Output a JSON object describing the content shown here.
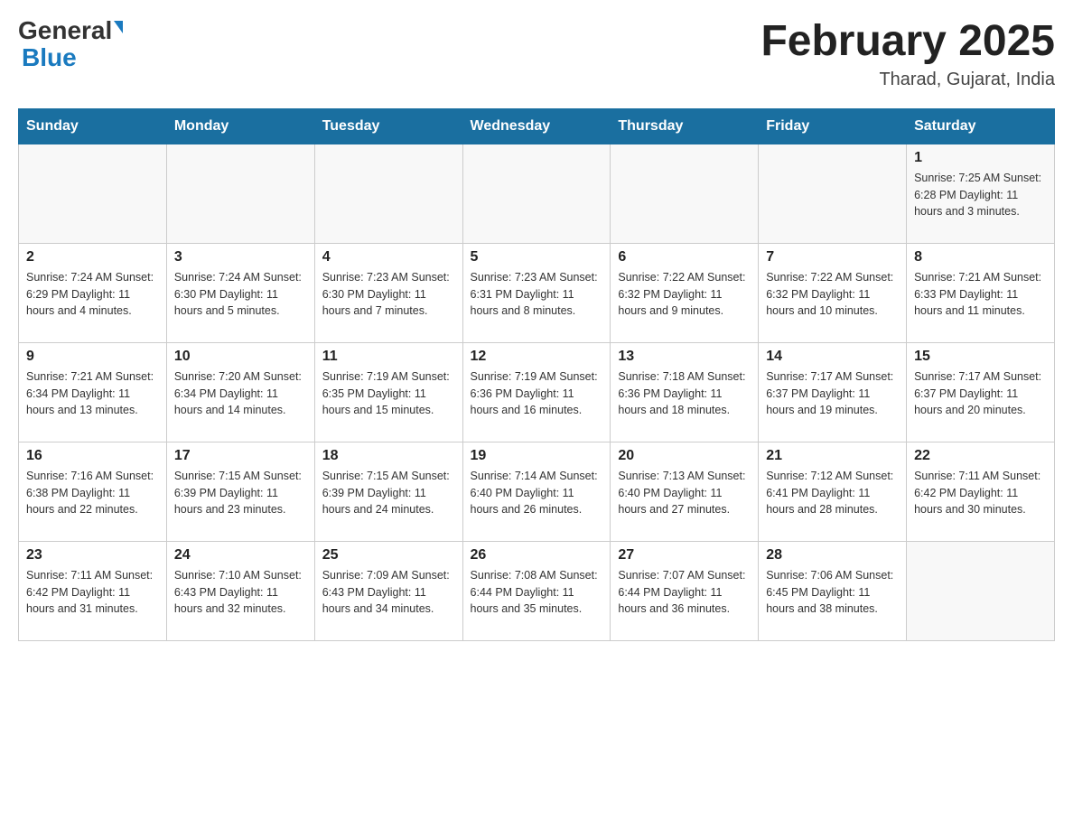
{
  "header": {
    "logo_general": "General",
    "logo_blue": "Blue",
    "month_title": "February 2025",
    "location": "Tharad, Gujarat, India"
  },
  "days_of_week": [
    "Sunday",
    "Monday",
    "Tuesday",
    "Wednesday",
    "Thursday",
    "Friday",
    "Saturday"
  ],
  "weeks": [
    [
      {
        "day": "",
        "info": ""
      },
      {
        "day": "",
        "info": ""
      },
      {
        "day": "",
        "info": ""
      },
      {
        "day": "",
        "info": ""
      },
      {
        "day": "",
        "info": ""
      },
      {
        "day": "",
        "info": ""
      },
      {
        "day": "1",
        "info": "Sunrise: 7:25 AM\nSunset: 6:28 PM\nDaylight: 11 hours and 3 minutes."
      }
    ],
    [
      {
        "day": "2",
        "info": "Sunrise: 7:24 AM\nSunset: 6:29 PM\nDaylight: 11 hours and 4 minutes."
      },
      {
        "day": "3",
        "info": "Sunrise: 7:24 AM\nSunset: 6:30 PM\nDaylight: 11 hours and 5 minutes."
      },
      {
        "day": "4",
        "info": "Sunrise: 7:23 AM\nSunset: 6:30 PM\nDaylight: 11 hours and 7 minutes."
      },
      {
        "day": "5",
        "info": "Sunrise: 7:23 AM\nSunset: 6:31 PM\nDaylight: 11 hours and 8 minutes."
      },
      {
        "day": "6",
        "info": "Sunrise: 7:22 AM\nSunset: 6:32 PM\nDaylight: 11 hours and 9 minutes."
      },
      {
        "day": "7",
        "info": "Sunrise: 7:22 AM\nSunset: 6:32 PM\nDaylight: 11 hours and 10 minutes."
      },
      {
        "day": "8",
        "info": "Sunrise: 7:21 AM\nSunset: 6:33 PM\nDaylight: 11 hours and 11 minutes."
      }
    ],
    [
      {
        "day": "9",
        "info": "Sunrise: 7:21 AM\nSunset: 6:34 PM\nDaylight: 11 hours and 13 minutes."
      },
      {
        "day": "10",
        "info": "Sunrise: 7:20 AM\nSunset: 6:34 PM\nDaylight: 11 hours and 14 minutes."
      },
      {
        "day": "11",
        "info": "Sunrise: 7:19 AM\nSunset: 6:35 PM\nDaylight: 11 hours and 15 minutes."
      },
      {
        "day": "12",
        "info": "Sunrise: 7:19 AM\nSunset: 6:36 PM\nDaylight: 11 hours and 16 minutes."
      },
      {
        "day": "13",
        "info": "Sunrise: 7:18 AM\nSunset: 6:36 PM\nDaylight: 11 hours and 18 minutes."
      },
      {
        "day": "14",
        "info": "Sunrise: 7:17 AM\nSunset: 6:37 PM\nDaylight: 11 hours and 19 minutes."
      },
      {
        "day": "15",
        "info": "Sunrise: 7:17 AM\nSunset: 6:37 PM\nDaylight: 11 hours and 20 minutes."
      }
    ],
    [
      {
        "day": "16",
        "info": "Sunrise: 7:16 AM\nSunset: 6:38 PM\nDaylight: 11 hours and 22 minutes."
      },
      {
        "day": "17",
        "info": "Sunrise: 7:15 AM\nSunset: 6:39 PM\nDaylight: 11 hours and 23 minutes."
      },
      {
        "day": "18",
        "info": "Sunrise: 7:15 AM\nSunset: 6:39 PM\nDaylight: 11 hours and 24 minutes."
      },
      {
        "day": "19",
        "info": "Sunrise: 7:14 AM\nSunset: 6:40 PM\nDaylight: 11 hours and 26 minutes."
      },
      {
        "day": "20",
        "info": "Sunrise: 7:13 AM\nSunset: 6:40 PM\nDaylight: 11 hours and 27 minutes."
      },
      {
        "day": "21",
        "info": "Sunrise: 7:12 AM\nSunset: 6:41 PM\nDaylight: 11 hours and 28 minutes."
      },
      {
        "day": "22",
        "info": "Sunrise: 7:11 AM\nSunset: 6:42 PM\nDaylight: 11 hours and 30 minutes."
      }
    ],
    [
      {
        "day": "23",
        "info": "Sunrise: 7:11 AM\nSunset: 6:42 PM\nDaylight: 11 hours and 31 minutes."
      },
      {
        "day": "24",
        "info": "Sunrise: 7:10 AM\nSunset: 6:43 PM\nDaylight: 11 hours and 32 minutes."
      },
      {
        "day": "25",
        "info": "Sunrise: 7:09 AM\nSunset: 6:43 PM\nDaylight: 11 hours and 34 minutes."
      },
      {
        "day": "26",
        "info": "Sunrise: 7:08 AM\nSunset: 6:44 PM\nDaylight: 11 hours and 35 minutes."
      },
      {
        "day": "27",
        "info": "Sunrise: 7:07 AM\nSunset: 6:44 PM\nDaylight: 11 hours and 36 minutes."
      },
      {
        "day": "28",
        "info": "Sunrise: 7:06 AM\nSunset: 6:45 PM\nDaylight: 11 hours and 38 minutes."
      },
      {
        "day": "",
        "info": ""
      }
    ]
  ]
}
